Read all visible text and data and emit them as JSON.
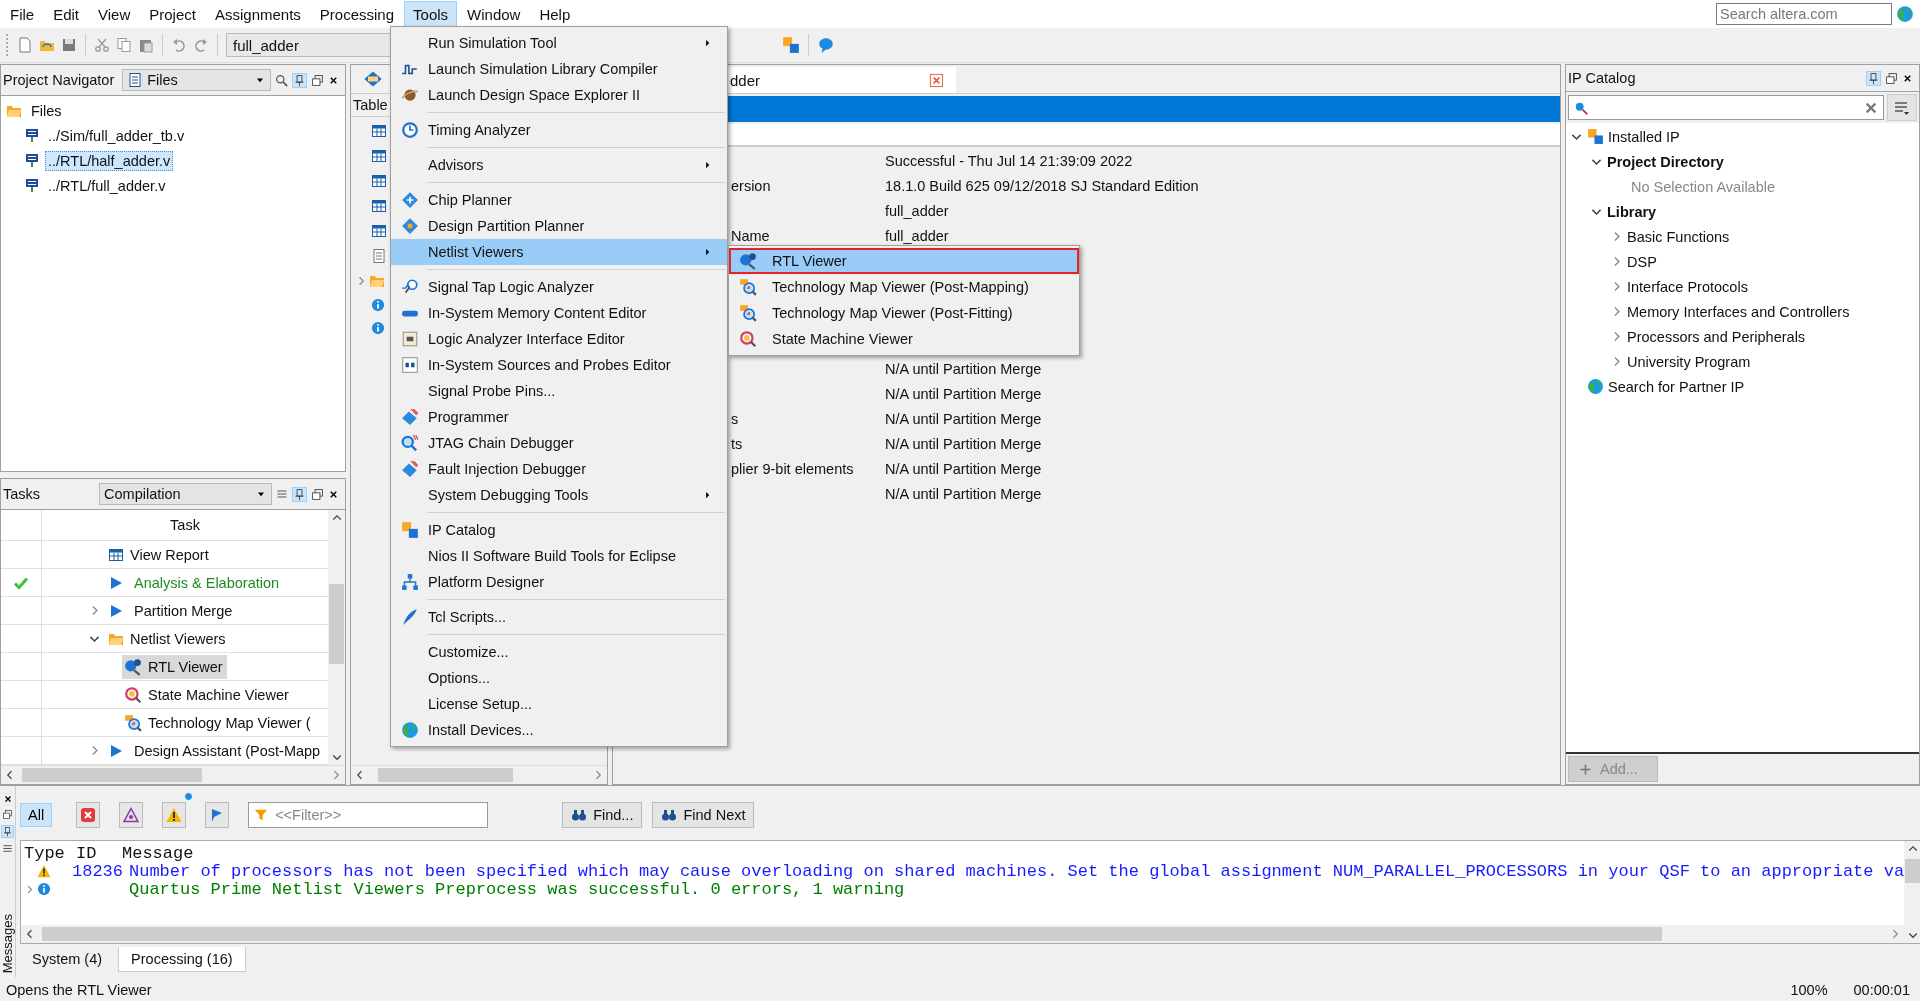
{
  "menu_bar": {
    "items": [
      {
        "label": "File",
        "selected": false
      },
      {
        "label": "Edit",
        "selected": false
      },
      {
        "label": "View",
        "selected": false
      },
      {
        "label": "Project",
        "selected": false
      },
      {
        "label": "Assignments",
        "selected": false
      },
      {
        "label": "Processing",
        "selected": false
      },
      {
        "label": "Tools",
        "selected": true
      },
      {
        "label": "Window",
        "selected": false
      },
      {
        "label": "Help",
        "selected": false
      }
    ],
    "search": {
      "placeholder": "Search altera.com"
    }
  },
  "toolbar": {
    "project": "full_adder"
  },
  "project_navigator": {
    "title": "Project Navigator",
    "view": "Files",
    "tree": [
      {
        "label": "Files",
        "kind": "folder",
        "children": [
          {
            "label": "../Sim/full_adder_tb.v",
            "kind": "file",
            "selected": false
          },
          {
            "label": "../RTL/half_adder.v",
            "kind": "file",
            "selected": true
          },
          {
            "label": "../RTL/full_adder.v",
            "kind": "file",
            "selected": false
          }
        ]
      }
    ]
  },
  "tasks": {
    "title": "Tasks",
    "flow": "Compilation",
    "column": "Task",
    "rows": [
      {
        "label": "View Report",
        "kind": "report",
        "done": false,
        "selected": false
      },
      {
        "label": "Analysis & Elaboration",
        "kind": "run",
        "done": true,
        "selected": false
      },
      {
        "label": "Partition Merge",
        "kind": "run",
        "done": false,
        "selected": false,
        "expanded": false
      },
      {
        "label": "Netlist Viewers",
        "kind": "folder",
        "done": false,
        "selected": false,
        "expanded": true,
        "children": [
          {
            "label": "RTL Viewer",
            "kind": "rtl",
            "selected": true
          },
          {
            "label": "State Machine Viewer",
            "kind": "fsm",
            "selected": false
          },
          {
            "label": "Technology Map Viewer (",
            "kind": "techmap",
            "selected": false
          }
        ]
      },
      {
        "label": "Design Assistant (Post-Mapp",
        "kind": "run",
        "done": false,
        "selected": false,
        "expanded": false
      }
    ]
  },
  "contents_panel": {
    "title": "Table"
  },
  "report": {
    "tab": "dder",
    "rows": [
      {
        "value": "Successful - Thu Jul 14 21:39:09 2022"
      },
      {
        "label": "ersion",
        "value": "18.1.0 Build 625 09/12/2018 SJ Standard Edition"
      },
      {
        "value": "full_adder"
      },
      {
        "label": "Name",
        "value": "full_adder"
      },
      {
        "value": "N/A until Partition Merge"
      },
      {
        "value": "N/A until Partition Merge"
      },
      {
        "label": "s",
        "value": "N/A until Partition Merge"
      },
      {
        "label": "ts",
        "value": "N/A until Partition Merge"
      },
      {
        "label": "plier 9-bit elements",
        "value": "N/A until Partition Merge"
      },
      {
        "value": "N/A until Partition Merge"
      }
    ]
  },
  "tools_menu": {
    "groups": [
      [
        {
          "label": "Run Simulation Tool",
          "kind": "plain",
          "submenu": true,
          "selected": false
        },
        {
          "label": "Launch Simulation Library Compiler",
          "kind": "simlib",
          "submenu": false,
          "selected": false
        },
        {
          "label": "Launch Design Space Explorer II",
          "kind": "planet",
          "submenu": false,
          "selected": false
        }
      ],
      [
        {
          "label": "Timing Analyzer",
          "kind": "clock",
          "submenu": false,
          "selected": false
        }
      ],
      [
        {
          "label": "Advisors",
          "kind": "plain",
          "submenu": true,
          "selected": false
        }
      ],
      [
        {
          "label": "Chip Planner",
          "kind": "chip",
          "submenu": false,
          "selected": false
        },
        {
          "label": "Design Partition Planner",
          "kind": "partition",
          "submenu": false,
          "selected": false
        },
        {
          "label": "Netlist Viewers",
          "kind": "plain",
          "submenu": true,
          "selected": true,
          "children": [
            {
              "label": "RTL Viewer",
              "kind": "rtl",
              "selected": true
            },
            {
              "label": "Technology Map Viewer (Post-Mapping)",
              "kind": "techmap",
              "selected": false
            },
            {
              "label": "Technology Map Viewer (Post-Fitting)",
              "kind": "techmap",
              "selected": false
            },
            {
              "label": "State Machine Viewer",
              "kind": "fsm",
              "selected": false
            }
          ]
        }
      ],
      [
        {
          "label": "Signal Tap Logic Analyzer",
          "kind": "tap",
          "submenu": false,
          "selected": false
        },
        {
          "label": "In-System Memory Content Editor",
          "kind": "memory",
          "submenu": false,
          "selected": false
        },
        {
          "label": "Logic Analyzer Interface Editor",
          "kind": "lai",
          "submenu": false,
          "selected": false
        },
        {
          "label": "In-System Sources and Probes Editor",
          "kind": "sources",
          "submenu": false,
          "selected": false
        },
        {
          "label": "Signal Probe Pins...",
          "kind": "plain",
          "submenu": false,
          "selected": false
        },
        {
          "label": "Programmer",
          "kind": "prog",
          "submenu": false,
          "selected": false
        },
        {
          "label": "JTAG Chain Debugger",
          "kind": "jtag",
          "submenu": false,
          "selected": false
        },
        {
          "label": "Fault Injection Debugger",
          "kind": "prog",
          "submenu": false,
          "selected": false
        },
        {
          "label": "System Debugging Tools",
          "kind": "plain",
          "submenu": true,
          "selected": false
        }
      ],
      [
        {
          "label": "IP Catalog",
          "kind": "ip",
          "submenu": false,
          "selected": false
        },
        {
          "label": "Nios II Software Build Tools for Eclipse",
          "kind": "plain",
          "submenu": false,
          "selected": false
        },
        {
          "label": "Platform Designer",
          "kind": "platform",
          "submenu": false,
          "selected": false
        }
      ],
      [
        {
          "label": "Tcl Scripts...",
          "kind": "quill",
          "submenu": false,
          "selected": false
        }
      ],
      [
        {
          "label": "Customize...",
          "kind": "plain",
          "submenu": false,
          "selected": false
        },
        {
          "label": "Options...",
          "kind": "plain",
          "submenu": false,
          "selected": false
        },
        {
          "label": "License Setup...",
          "kind": "plain",
          "submenu": false,
          "selected": false
        },
        {
          "label": "Install Devices...",
          "kind": "globe",
          "submenu": false,
          "selected": false
        }
      ]
    ]
  },
  "ip_catalog": {
    "title": "IP Catalog",
    "tree": [
      {
        "label": "Installed IP",
        "kind": "ip",
        "expanded": true,
        "children": [
          {
            "label": "Project Directory",
            "kind": "group",
            "expanded": true,
            "children": [
              {
                "label": "No Selection Available",
                "kind": "note"
              }
            ]
          },
          {
            "label": "Library",
            "kind": "group",
            "expanded": true,
            "children": [
              {
                "label": "Basic Functions",
                "kind": "category",
                "expanded": false
              },
              {
                "label": "DSP",
                "kind": "category",
                "expanded": false
              },
              {
                "label": "Interface Protocols",
                "kind": "category",
                "expanded": false
              },
              {
                "label": "Memory Interfaces and Controllers",
                "kind": "category",
                "expanded": false
              },
              {
                "label": "Processors and Peripherals",
                "kind": "category",
                "expanded": false
              },
              {
                "label": "University Program",
                "kind": "category",
                "expanded": false
              }
            ]
          }
        ]
      },
      {
        "label": "Search for Partner IP",
        "kind": "partner"
      }
    ],
    "add_button": {
      "label": "Add...",
      "disabled": true
    }
  },
  "messages": {
    "title": "Messages",
    "filters": [
      {
        "kind": "all",
        "label": "All",
        "selected": true
      },
      {
        "kind": "error",
        "selected": false
      },
      {
        "kind": "critical",
        "selected": false
      },
      {
        "kind": "warning",
        "selected": false
      },
      {
        "kind": "suppressed",
        "selected": false
      }
    ],
    "filter_field": {
      "placeholder": "<<Filter>>"
    },
    "find_buttons": [
      "Find...",
      "Find Next"
    ],
    "columns": [
      "Type",
      "ID",
      "Message"
    ],
    "rows": [
      {
        "kind": "warning",
        "id": "18236",
        "text": "Number of processors has not been specified which may cause overloading on shared machines.  Set the global assignment NUM_PARALLEL_PROCESSORS in your QSF to an appropriate va"
      },
      {
        "kind": "info",
        "text": "Quartus Prime Netlist Viewers Preprocess was successful. 0 errors, 1 warning",
        "expanded": false
      }
    ],
    "tabs": [
      {
        "label": "System (4)",
        "selected": false
      },
      {
        "label": "Processing (16)",
        "selected": true
      }
    ]
  },
  "status_bar": {
    "text": "Opens the RTL Viewer",
    "zoom": "100%",
    "time": "00:00:01"
  }
}
